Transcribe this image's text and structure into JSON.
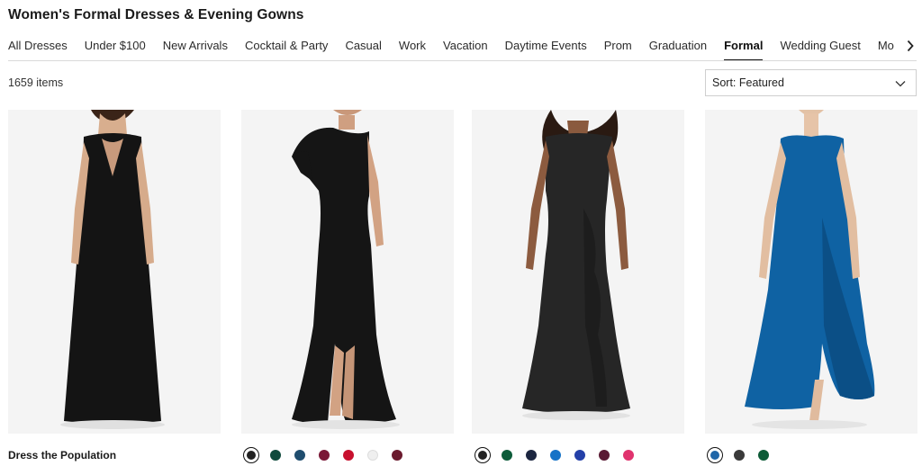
{
  "page": {
    "title": "Women's Formal Dresses & Evening Gowns"
  },
  "nav": {
    "tabs": [
      {
        "label": "All Dresses",
        "active": false
      },
      {
        "label": "Under $100",
        "active": false
      },
      {
        "label": "New Arrivals",
        "active": false
      },
      {
        "label": "Cocktail & Party",
        "active": false
      },
      {
        "label": "Casual",
        "active": false
      },
      {
        "label": "Work",
        "active": false
      },
      {
        "label": "Vacation",
        "active": false
      },
      {
        "label": "Daytime Events",
        "active": false
      },
      {
        "label": "Prom",
        "active": false
      },
      {
        "label": "Graduation",
        "active": false
      },
      {
        "label": "Formal",
        "active": true
      },
      {
        "label": "Wedding Guest",
        "active": false
      },
      {
        "label": "Mother of the Bride",
        "active": false
      }
    ],
    "scroll_icon": "chevron-right-icon"
  },
  "results": {
    "count_text": "1659 items"
  },
  "sort": {
    "label": "Sort: Featured",
    "icon": "chevron-down-icon"
  },
  "products": [
    {
      "brand": "Dress the Population",
      "dress_color": "#141414",
      "swatches": []
    },
    {
      "brand": "",
      "dress_color": "#151515",
      "swatches": [
        {
          "color": "#222222",
          "selected": true
        },
        {
          "color": "#0f4a3c",
          "selected": false
        },
        {
          "color": "#1f4d6e",
          "selected": false
        },
        {
          "color": "#7a1836",
          "selected": false
        },
        {
          "color": "#c8102e",
          "selected": false
        },
        {
          "color": "#efefef",
          "selected": false
        },
        {
          "color": "#6b1a2e",
          "selected": false
        }
      ]
    },
    {
      "brand": "",
      "dress_color": "#262626",
      "swatches": [
        {
          "color": "#222222",
          "selected": true
        },
        {
          "color": "#0d5c3a",
          "selected": false
        },
        {
          "color": "#1c2640",
          "selected": false
        },
        {
          "color": "#1673c7",
          "selected": false
        },
        {
          "color": "#2440a8",
          "selected": false
        },
        {
          "color": "#5a1a34",
          "selected": false
        },
        {
          "color": "#e0336e",
          "selected": false
        }
      ]
    },
    {
      "brand": "",
      "dress_color": "#0f62a3",
      "swatches": [
        {
          "color": "#1f66a8",
          "selected": true
        },
        {
          "color": "#3a3a3a",
          "selected": false
        },
        {
          "color": "#0d5b37",
          "selected": false
        }
      ]
    }
  ]
}
